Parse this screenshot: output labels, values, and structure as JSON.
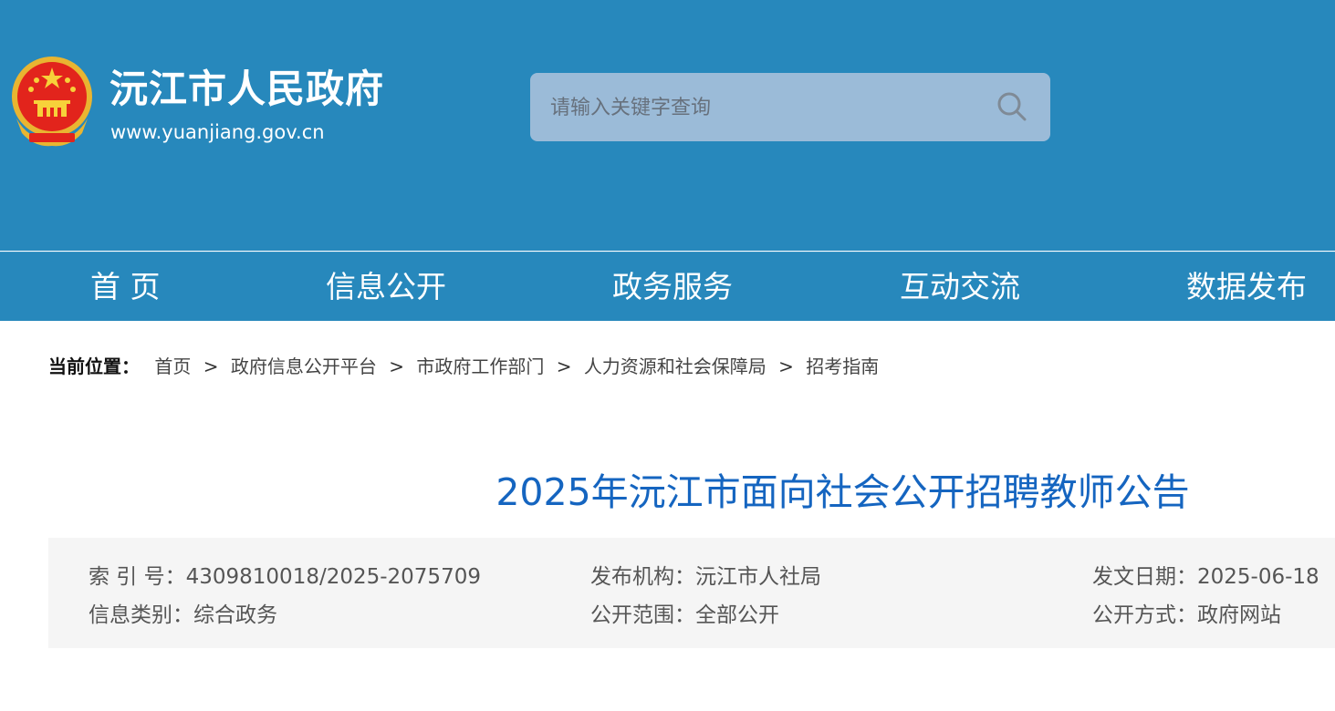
{
  "header": {
    "site_name": "沅江市人民政府",
    "site_url": "www.yuanjiang.gov.cn",
    "search_placeholder": "请输入关键字查询"
  },
  "nav": {
    "items": [
      "首 页",
      "信息公开",
      "政务服务",
      "互动交流",
      "数据发布"
    ]
  },
  "breadcrumb": {
    "label": "当前位置：",
    "items": [
      "首页",
      "政府信息公开平台",
      "市政府工作部门",
      "人力资源和社会保障局",
      "招考指南"
    ],
    "separator": ">"
  },
  "article": {
    "title": "2025年沅江市面向社会公开招聘教师公告"
  },
  "meta": {
    "index_no": "索 引 号：4309810018/2025-2075709",
    "publisher": "发布机构：沅江市人社局",
    "date": "发文日期：2025-06-18",
    "category": "信息类别：综合政务",
    "scope": "公开范围：全部公开",
    "method": "公开方式：政府网站"
  },
  "colors": {
    "header_bg": "#2788bc",
    "title_blue": "#1565c0",
    "meta_bg": "#f5f5f5"
  }
}
